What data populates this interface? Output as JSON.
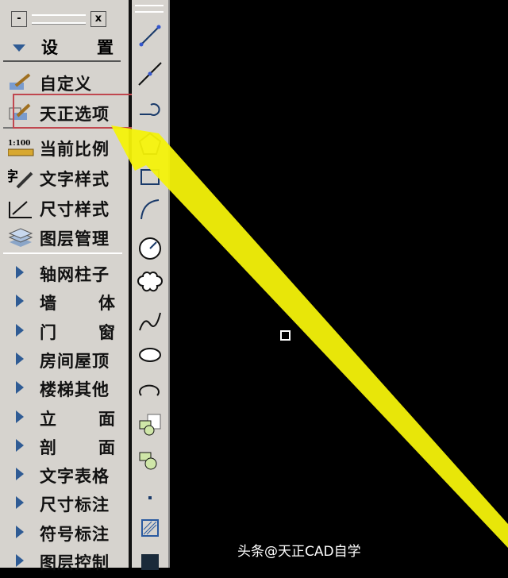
{
  "panel": {
    "title_buttons": {
      "minimize": "-",
      "close": "x"
    },
    "section": {
      "label_a": "设",
      "label_b": "置"
    },
    "settings_items": [
      {
        "label": "自定义",
        "icon": "brush-icon"
      },
      {
        "label": "天正选项",
        "icon": "options-icon",
        "highlighted": true
      },
      {
        "label": "当前比例",
        "icon": "scale-ruler-icon",
        "icon_text": "1:100"
      },
      {
        "label": "文字样式",
        "icon": "text-style-icon",
        "icon_text": "字"
      },
      {
        "label": "尺寸样式",
        "icon": "dimension-style-icon"
      },
      {
        "label": "图层管理",
        "icon": "layers-icon"
      }
    ],
    "menu_items": [
      {
        "label": "轴网柱子"
      },
      {
        "a": "墙",
        "b": "体"
      },
      {
        "a": "门",
        "b": "窗"
      },
      {
        "label": "房间屋顶"
      },
      {
        "label": "楼梯其他"
      },
      {
        "a": "立",
        "b": "面"
      },
      {
        "a": "剖",
        "b": "面"
      },
      {
        "label": "文字表格"
      },
      {
        "label": "尺寸标注"
      },
      {
        "label": "符号标注"
      },
      {
        "label": "图层控制"
      }
    ]
  },
  "toolbar": [
    "line",
    "construction-line",
    "polyline",
    "polygon",
    "rectangle",
    "arc",
    "circle",
    "revision-cloud",
    "spline",
    "ellipse",
    "ellipse-arc",
    "insert-block",
    "make-block",
    "point",
    "hatch",
    "gradient"
  ],
  "watermark": "头条@天正CAD自学",
  "colors": {
    "panel": "#d6d3ce",
    "arrow": "#f4f20a",
    "highlight": "#c0474f",
    "triangle": "#2f5b94"
  }
}
